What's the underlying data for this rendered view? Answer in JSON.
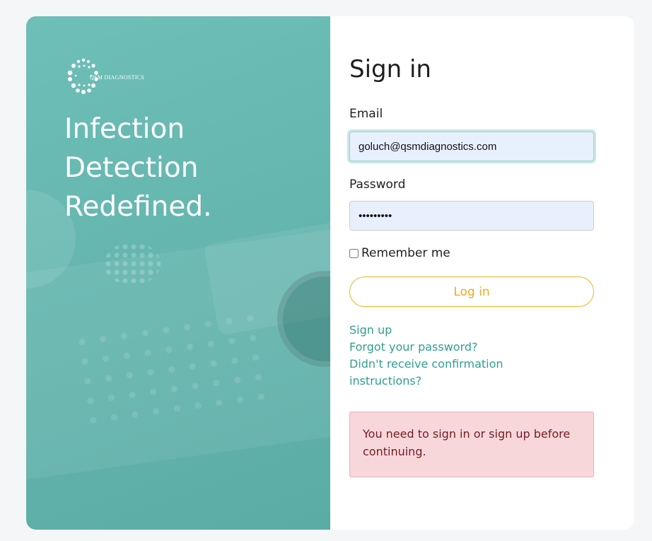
{
  "hero": {
    "logo_text": "QSM DIAGNOSTICS",
    "tagline": [
      "Infection",
      "Detection",
      "Redefined."
    ]
  },
  "form": {
    "title": "Sign in",
    "email_label": "Email",
    "email_value": "goluch@qsmdiagnostics.com",
    "password_label": "Password",
    "password_value": "•••••••••",
    "remember_label": "Remember me",
    "login_label": "Log in"
  },
  "links": {
    "sign_up": "Sign up",
    "forgot_password": "Forgot your password?",
    "confirmation": "Didn't receive confirmation instructions?"
  },
  "alert": {
    "message": "You need to sign in or sign up before continuing."
  },
  "colors": {
    "hero_teal": "#66b7b0",
    "link_teal": "#2f9f93",
    "button_accent": "#f0b323",
    "alert_bg": "#f8d7da",
    "alert_text": "#721c24"
  }
}
